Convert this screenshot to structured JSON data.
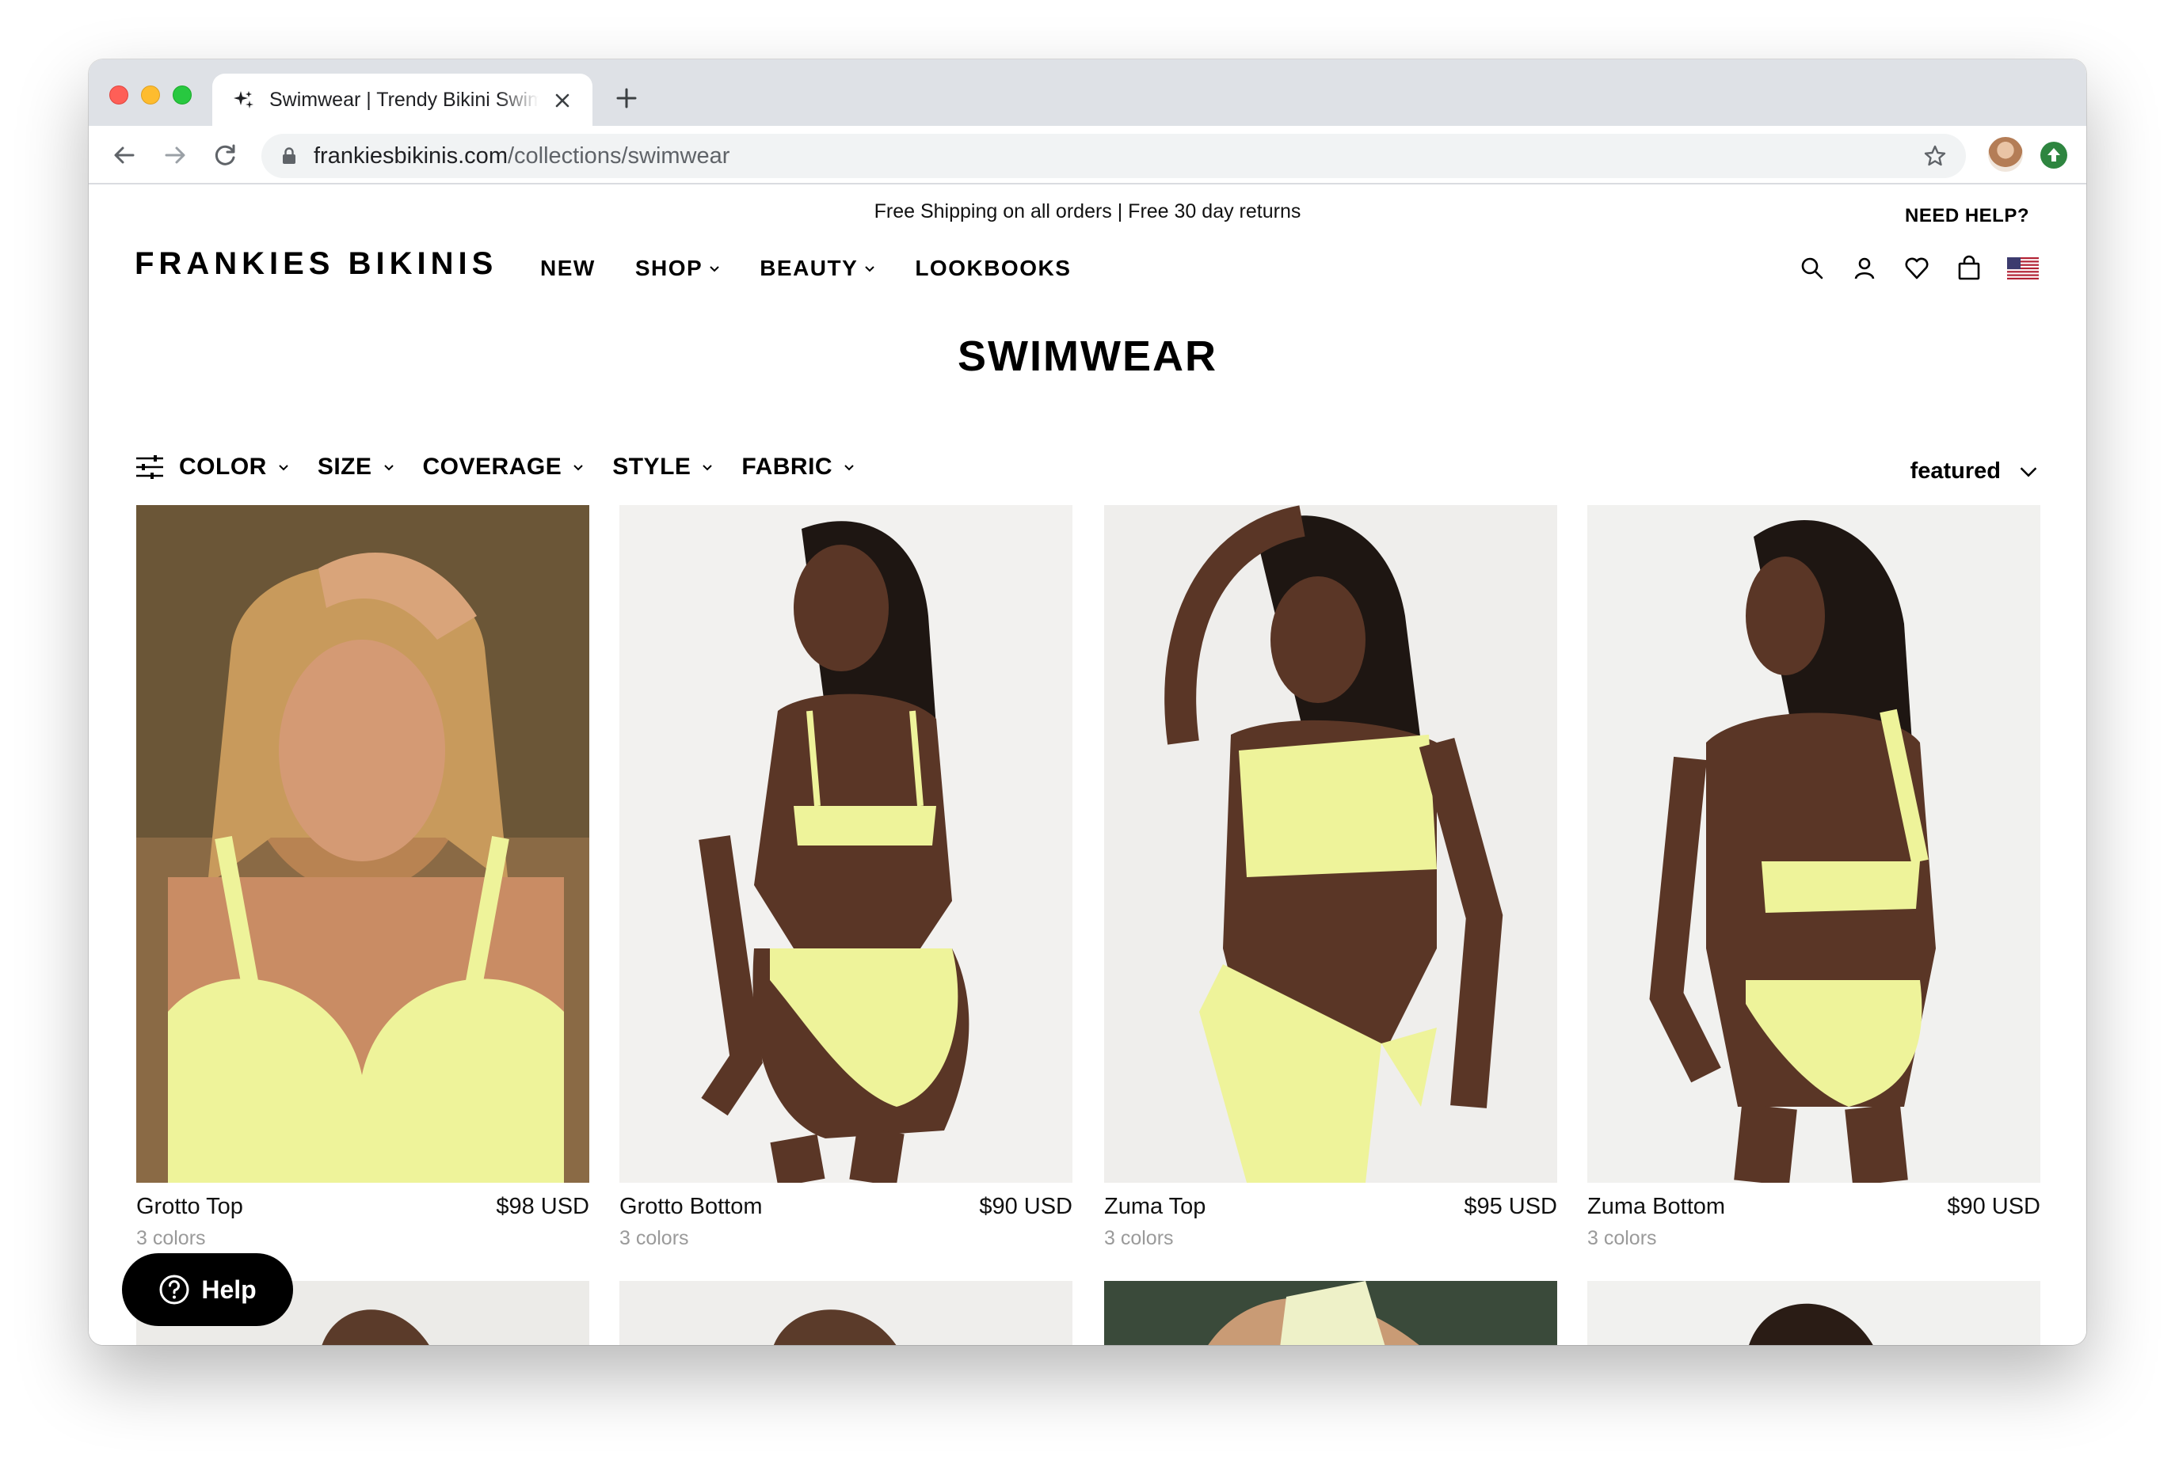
{
  "browser": {
    "tab_title": "Swimwear | Trendy Bikini Swimwear",
    "url_host": "frankiesbikinis.com",
    "url_path": "/collections/swimwear"
  },
  "site": {
    "announcement": "Free Shipping on all orders | Free 30 day returns",
    "need_help": "NEED HELP?",
    "logo": "FRANKIES BIKINIS",
    "nav": [
      "NEW",
      "SHOP",
      "BEAUTY",
      "LOOKBOOKS"
    ],
    "header_icons": [
      "search-icon",
      "account-icon",
      "heart-icon",
      "bag-icon",
      "us-flag-icon"
    ]
  },
  "collection": {
    "title": "SWIMWEAR",
    "filters": [
      "COLOR",
      "SIZE",
      "COVERAGE",
      "STYLE",
      "FABRIC"
    ],
    "sort_label": "featured"
  },
  "products": [
    {
      "name": "Grotto Top",
      "price": "$98 USD",
      "colors": "3 colors"
    },
    {
      "name": "Grotto Bottom",
      "price": "$90 USD",
      "colors": "3 colors"
    },
    {
      "name": "Zuma Top",
      "price": "$95 USD",
      "colors": "3 colors"
    },
    {
      "name": "Zuma Bottom",
      "price": "$90 USD",
      "colors": "3 colors"
    }
  ],
  "help_button": "Help",
  "colors": {
    "swim_yellow": "#eef39a",
    "accent": "#000000"
  }
}
